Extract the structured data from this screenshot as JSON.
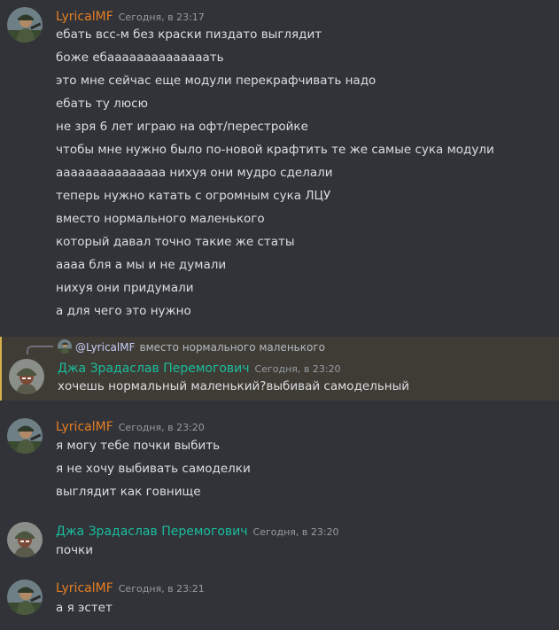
{
  "colors": {
    "background": "#313338",
    "highlight_background": "#3f3c35",
    "highlight_border": "#d6b14a",
    "username_orange": "#e67e22",
    "username_green": "#1abc9c",
    "timestamp": "#949ba4",
    "text": "#dbdee1",
    "mention": "#c9cdfb"
  },
  "groups": [
    {
      "author": "LyricalMF",
      "timestamp": "Сегодня, в 23:17",
      "avatar_icon": "soldier-avatar-icon",
      "messages": [
        "ебать всс-м без краски пиздато выглядит",
        "боже ебаааааааааааааать",
        "это мне сейчас еще модули перекрафчивать надо",
        "ебать ту люсю",
        "не зря 6 лет играю на офт/перестройке",
        "чтобы мне нужно было по-новой крафтить те же самые сука модули",
        "ааааааааааааааа нихуя они мудро сделали",
        "теперь нужно катать с огромным сука ЛЦУ",
        "вместо нормального маленького",
        "который давал точно такие же статы",
        "аааа бля а мы и не думали",
        "нихуя они придумали",
        "а для чего это нужно"
      ]
    },
    {
      "author": "Джа Зрадаслав Перемогович",
      "timestamp": "Сегодня, в 23:20",
      "avatar_icon": "helmet-man-avatar-icon",
      "reply": {
        "mention": "@LyricalMF",
        "text": "вместо нормального маленького"
      },
      "messages": [
        "хочешь нормальный маленький?выбивай самодельный"
      ]
    },
    {
      "author": "LyricalMF",
      "timestamp": "Сегодня, в 23:20",
      "avatar_icon": "soldier-avatar-icon",
      "messages": [
        "я могу тебе почки выбить",
        "я не хочу выбивать самоделки",
        "выглядит как говнище"
      ]
    },
    {
      "author": "Джа Зрадаслав Перемогович",
      "timestamp": "Сегодня, в 23:20",
      "avatar_icon": "helmet-man-avatar-icon",
      "messages": [
        "почки"
      ]
    },
    {
      "author": "LyricalMF",
      "timestamp": "Сегодня, в 23:21",
      "avatar_icon": "soldier-avatar-icon",
      "messages": [
        "а я эстет"
      ]
    }
  ]
}
